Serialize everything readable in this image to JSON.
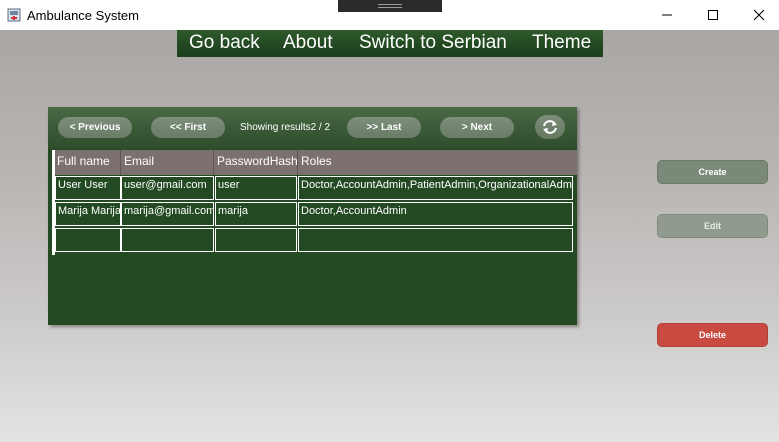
{
  "window": {
    "title": "Ambulance System"
  },
  "menu": {
    "go_back": "Go back",
    "about": "About",
    "switch_language": "Switch to Serbian",
    "theme": "Theme"
  },
  "pager": {
    "previous": "< Previous",
    "first": "<< First",
    "showing": "Showing results2 / 2",
    "last": ">> Last",
    "next": "> Next"
  },
  "table": {
    "columns": [
      "Full name",
      "Email",
      "PasswordHash",
      "Roles"
    ],
    "rows": [
      [
        "User User",
        "user@gmail.com",
        "user",
        "Doctor,AccountAdmin,PatientAdmin,OrganizationalAdmin"
      ],
      [
        "Marija Marija",
        "marija@gmail.com",
        "marija",
        "Doctor,AccountAdmin"
      ],
      [
        "",
        "",
        "",
        ""
      ]
    ]
  },
  "actions": {
    "create": "Create",
    "edit": "Edit",
    "delete": "Delete"
  },
  "colors": {
    "accent_green": "#234a22",
    "delete_red": "#c94a40"
  },
  "icons": [
    "app-icon",
    "minimize-icon",
    "maximize-icon",
    "close-icon",
    "refresh-icon"
  ]
}
